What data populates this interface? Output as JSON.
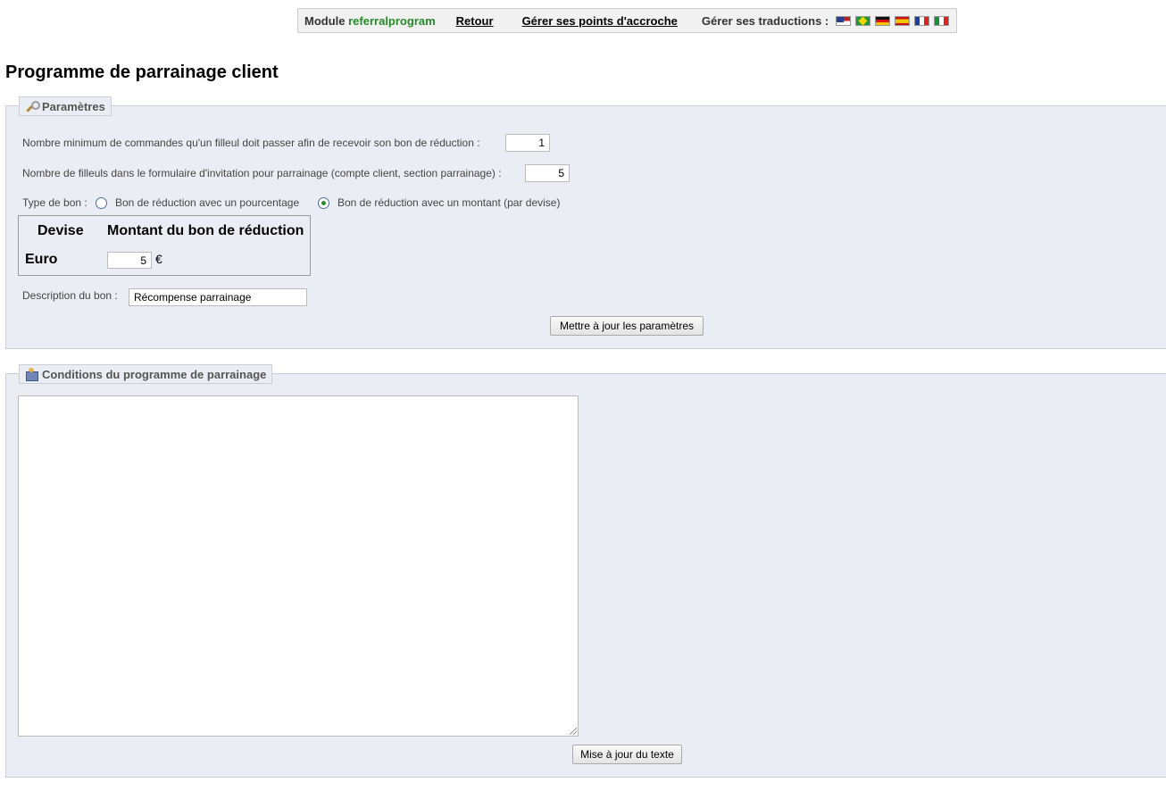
{
  "topbar": {
    "module_prefix": "Module",
    "module_name": "referralprogram",
    "back_link": "Retour",
    "hooks_link": "Gérer ses points d'accroche",
    "translations_label": "Gérer ses traductions :",
    "flags": [
      "us-flag",
      "br-flag",
      "de-flag",
      "es-flag",
      "fr-flag",
      "it-flag"
    ]
  },
  "page": {
    "title": "Programme de parrainage client"
  },
  "params": {
    "legend": "Paramètres",
    "min_orders_label": "Nombre minimum de commandes qu'un filleul doit passer afin de recevoir son bon de réduction :",
    "min_orders_value": "1",
    "nb_friends_label": "Nombre de filleuls dans le formulaire d'invitation pour parrainage (compte client, section parrainage) :",
    "nb_friends_value": "5",
    "voucher_type_label": "Type de bon :",
    "voucher_type_options": [
      {
        "label": "Bon de réduction avec un pourcentage",
        "checked": false
      },
      {
        "label": "Bon de réduction avec un montant (par devise)",
        "checked": true
      }
    ],
    "currency_table": {
      "headers": [
        "Devise",
        "Montant du bon de réduction"
      ],
      "rows": [
        {
          "currency": "Euro",
          "amount": "5",
          "symbol": "€"
        }
      ]
    },
    "description_label": "Description du bon :",
    "description_value": "Récompense parrainage",
    "submit_label": "Mettre à jour les paramètres"
  },
  "conditions": {
    "legend": "Conditions du programme de parrainage",
    "text_value": "",
    "submit_label": "Mise à jour du texte"
  }
}
